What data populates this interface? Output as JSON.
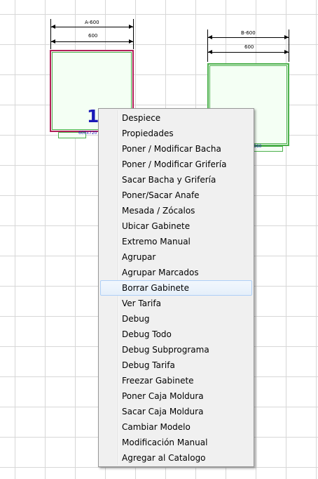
{
  "cabinet_a": {
    "dim_top": "A-600",
    "dim_width": "600",
    "number": "1",
    "sub_label": "600x720"
  },
  "cabinet_b": {
    "dim_top": "B-600",
    "dim_width": "600",
    "sub_label": "560"
  },
  "colors": {
    "selected_border": "#b3205a",
    "cabinet_border": "#4db04d",
    "label_blue": "#1a1ab8",
    "menu_bg": "#f0f0f0",
    "highlight_border": "#aecff7"
  },
  "context_menu": {
    "items": [
      "Despiece",
      "Propiedades",
      "Poner / Modificar Bacha",
      "Poner / Modificar Grifería",
      "Sacar Bacha y Grifería",
      "Poner/Sacar Anafe",
      "Mesada / Zócalos",
      "Ubicar Gabinete",
      "Extremo Manual",
      "Agrupar",
      "Agrupar Marcados",
      "Borrar Gabinete",
      "Ver Tarifa",
      "Debug",
      "Debug Todo",
      "Debug Subprograma",
      "Debug Tarifa",
      "Freezar Gabinete",
      "Poner Caja Moldura",
      "Sacar Caja Moldura",
      "Cambiar Modelo",
      "Modificación Manual",
      "Agregar al Catalogo"
    ],
    "highlighted": "Borrar Gabinete"
  }
}
